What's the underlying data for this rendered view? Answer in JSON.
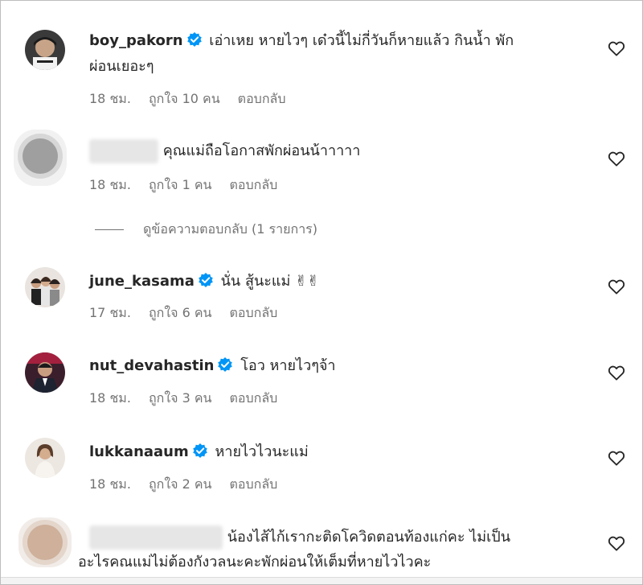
{
  "comments": [
    {
      "username": "boy_pakorn",
      "verified": true,
      "text_line1": "เอ่าเหย หายไวๆ เด๋วนี้ไม่กี่วันก็หายแล้ว กินน้ำ พัก",
      "text_line2": "ผ่อนเยอะๆ",
      "time": "18 ชม.",
      "likes": "ถูกใจ 10 คน",
      "reply": "ตอบกลับ",
      "avatar_icon": "avatar-man-cap"
    },
    {
      "username": "",
      "verified": false,
      "text_line1": "คุณแม่ถือโอกาสพักผ่อนน้าาาาา",
      "time": "18 ชม.",
      "likes": "ถูกใจ 1 คน",
      "reply": "ตอบกลับ",
      "avatar_icon": "avatar-blurred"
    },
    {
      "username": "june_kasama",
      "verified": true,
      "text_line1": "นั่น สู้นะแม่ ✌✌",
      "time": "17 ชม.",
      "likes": "ถูกใจ 6 คน",
      "reply": "ตอบกลับ",
      "avatar_icon": "avatar-group-photo"
    },
    {
      "username": "nut_devahastin",
      "verified": true,
      "text_line1": "โอว หายไวๆจ้า",
      "time": "18 ชม.",
      "likes": "ถูกใจ 3 คน",
      "reply": "ตอบกลับ",
      "avatar_icon": "avatar-man-suit"
    },
    {
      "username": "lukkanaaum",
      "verified": true,
      "text_line1": "หายไวไวนะแม่",
      "time": "18 ชม.",
      "likes": "ถูกใจ 2 คน",
      "reply": "ตอบกลับ",
      "avatar_icon": "avatar-woman"
    },
    {
      "username": "",
      "verified": false,
      "text_line1": "น้องไส้ไก้เรากะติดโควิดตอนท้องแก่คะ ไม่เป็น",
      "text_line2": "อะไรคณแม่ไม่ต้องกังวลนะคะพักผ่อนให้เต็มที่หายไวไวคะ",
      "avatar_icon": "avatar-blurred"
    }
  ],
  "view_replies": "ดูข้อความตอบกลับ (1 รายการ)",
  "icons": {
    "heart": "heart-outline-icon",
    "verified": "verified-badge-icon"
  },
  "colors": {
    "verified_blue": "#0095f6",
    "text": "#262626",
    "meta": "#737373"
  }
}
